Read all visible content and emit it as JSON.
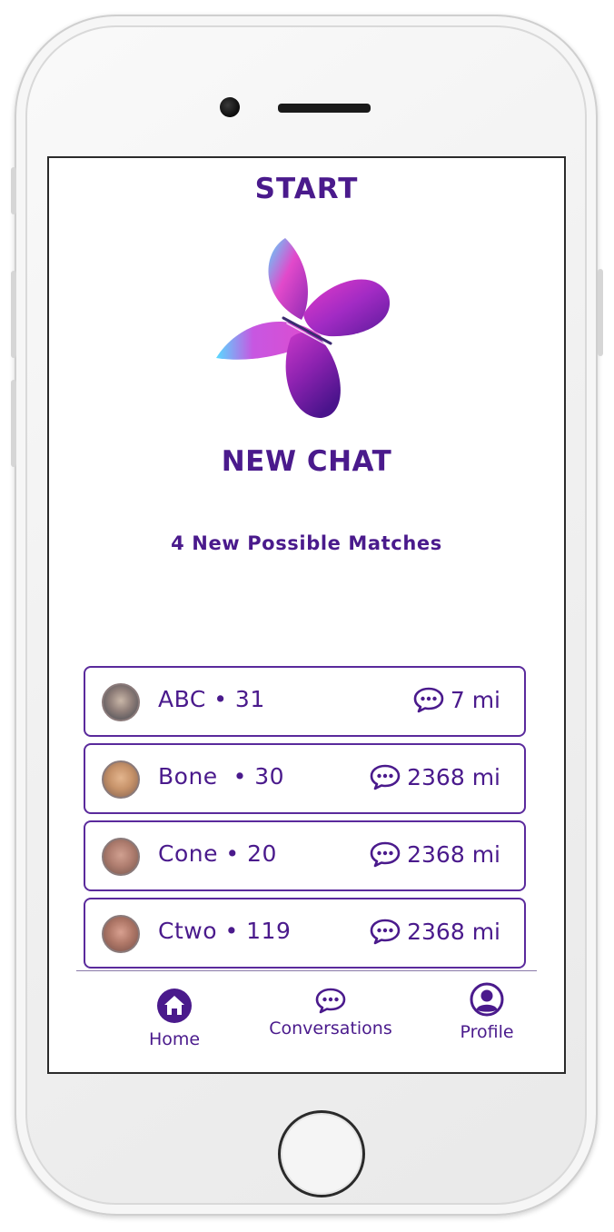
{
  "header": {
    "title": "START"
  },
  "hero": {
    "heading": "NEW CHAT",
    "matches_text": "4 New Possible Matches"
  },
  "matches": [
    {
      "name": "ABC • 31",
      "distance": "7 mi"
    },
    {
      "name": "Bone  • 30",
      "distance": "2368 mi"
    },
    {
      "name": "Cone • 20",
      "distance": "2368 mi"
    },
    {
      "name": "Ctwo • 119",
      "distance": "2368 mi"
    }
  ],
  "tabbar": {
    "home": "Home",
    "conversations": "Conversations",
    "profile": "Profile"
  },
  "icons": {
    "home": "home-icon",
    "conversations": "chat-bubble-icon",
    "profile": "user-circle-icon",
    "match_action": "chat-bubble-icon"
  },
  "colors": {
    "primary": "#4a1a8c",
    "border": "#5a2a9c",
    "logo_pink": "#e040c8",
    "logo_cyan": "#4fd8ff",
    "logo_purple": "#6a1fa8"
  }
}
